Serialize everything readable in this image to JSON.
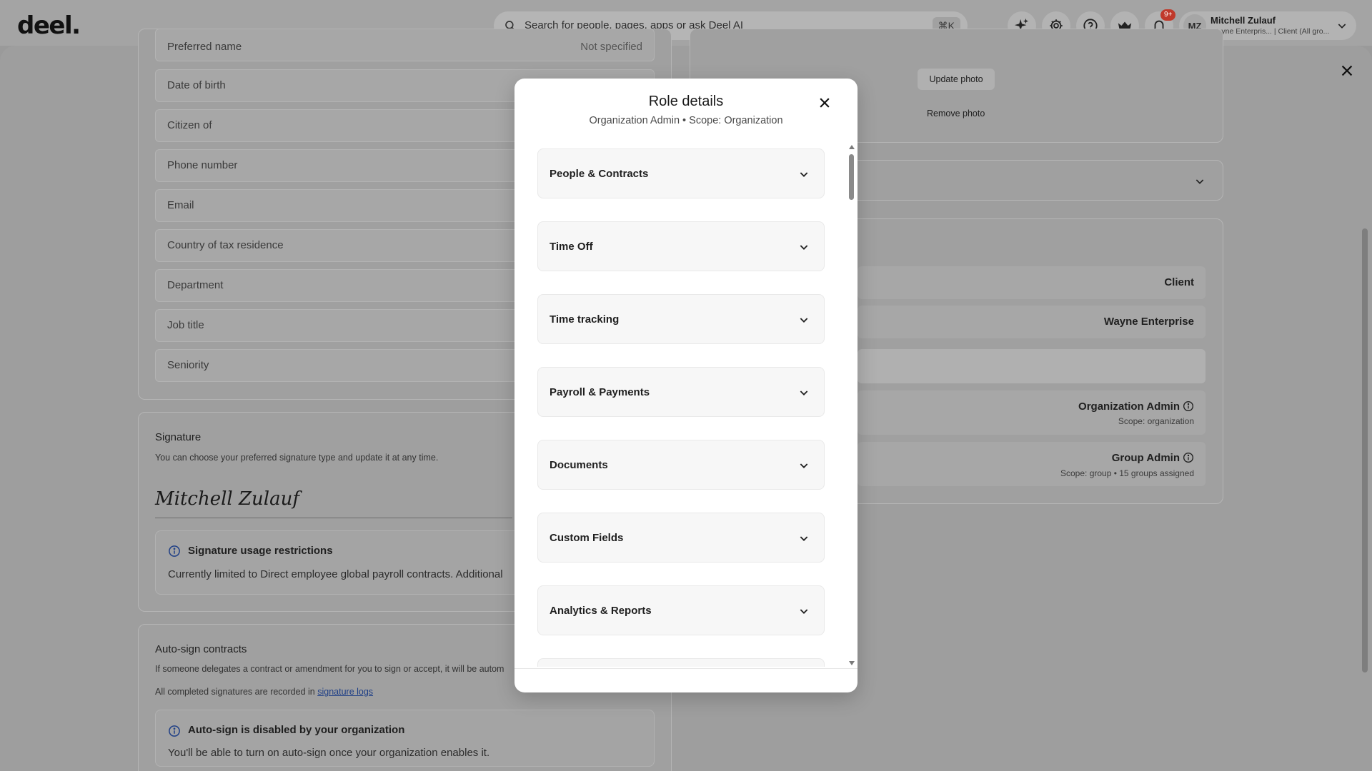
{
  "app": {
    "logo": "deel.",
    "search_placeholder": "Search for people, pages, apps or ask Deel AI",
    "search_shortcut": "⌘K",
    "notifications_badge": "9+",
    "user": {
      "initials": "MZ",
      "name": "Mitchell Zulauf",
      "subtitle": "Wayne Enterpris... | Client (All gro..."
    }
  },
  "profile": {
    "fields": [
      {
        "label": "Preferred name",
        "value": "Not specified"
      },
      {
        "label": "Date of birth",
        "value": ""
      },
      {
        "label": "Citizen of",
        "value": ""
      },
      {
        "label": "Phone number",
        "value": ""
      },
      {
        "label": "Email",
        "value": ""
      },
      {
        "label": "Country of tax residence",
        "value": ""
      },
      {
        "label": "Department",
        "value": ""
      },
      {
        "label": "Job title",
        "value": ""
      },
      {
        "label": "Seniority",
        "value": ""
      }
    ],
    "photo": {
      "update_label": "Update photo",
      "remove_label": "Remove photo"
    },
    "roles": {
      "user_type": "Client",
      "organization": "Wayne Enterprise",
      "role_1": {
        "name": "Organization Admin",
        "scope": "Scope: organization"
      },
      "role_2": {
        "name": "Group Admin",
        "scope": "Scope: group • 15 groups assigned"
      }
    }
  },
  "signature": {
    "title": "Signature",
    "description": "You can choose your preferred signature type and update it at any time.",
    "name": "Mitchell Zulauf",
    "restrictions_title": "Signature usage restrictions",
    "restrictions_text": "Currently limited to Direct employee global payroll contracts. Additional"
  },
  "auto_sign": {
    "title": "Auto-sign contracts",
    "description": "If someone delegates a contract or amendment for you to sign or accept, it will be autom",
    "logs_text": "All completed signatures are recorded in",
    "logs_link": "signature logs",
    "disabled_title": "Auto-sign is disabled by your organization",
    "disabled_text": "You'll be able to turn on auto-sign once your organization enables it."
  },
  "modal": {
    "title": "Role details",
    "subtitle": "Organization Admin • Scope: Organization",
    "sections": [
      {
        "label": "People & Contracts"
      },
      {
        "label": "Time Off"
      },
      {
        "label": "Time tracking"
      },
      {
        "label": "Payroll & Payments"
      },
      {
        "label": "Documents"
      },
      {
        "label": "Custom Fields"
      },
      {
        "label": "Analytics & Reports"
      },
      {
        "label": ""
      }
    ]
  },
  "colors": {
    "overlay": "#9e9e9e",
    "modal_bg": "#ffffff",
    "accordion_bg": "#f7f7f7",
    "link": "#1f3f86",
    "badge": "#c0392b"
  }
}
